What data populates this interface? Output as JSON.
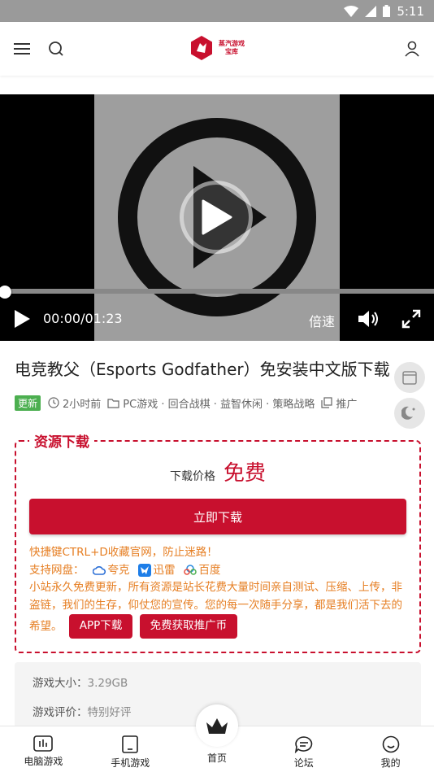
{
  "status": {
    "time": "5:11"
  },
  "header": {
    "logo_line1": "蒸汽游戏",
    "logo_line2": "宝库"
  },
  "video": {
    "time_display": "00:00/01:23",
    "speed_label": "倍速",
    "progress": 0.0
  },
  "article": {
    "title": "电竞教父（Esports Godfather）免安装中文版下载",
    "badge": "更新",
    "time_ago": "2小时前",
    "categories": "PC游戏 · 回合战棋 · 益智休闲 · 策略战略",
    "recommend": "推广"
  },
  "download": {
    "section_title": "资源下载",
    "price_label": "下载价格",
    "price_value": "免费",
    "button_label": "立即下载",
    "note_bookmark": "快捷键CTRL+D收藏官网，防止迷路！",
    "netdisk_label": "支持网盘：",
    "netdisks": [
      "夸克",
      "迅雷",
      "百度"
    ],
    "note_free": "小站永久免费更新，所有资源是站长花费大量时间亲自测试、压缩、上传，非盗链，我们的生存，仰仗您的宣传。您的每一次随手分享，都是我们活下去的希望。",
    "app_button": "APP下载",
    "promo_button": "免费获取推广币"
  },
  "info": {
    "size_label": "游戏大小：",
    "size_value": "3.29GB",
    "rating_label": "游戏评价：",
    "rating_value": "特别好评"
  },
  "tabbar": {
    "items": [
      {
        "label": "电脑游戏",
        "icon": "bar-chart-icon"
      },
      {
        "label": "手机游戏",
        "icon": "tablet-icon"
      },
      {
        "label": "首页",
        "icon": "crown-icon"
      },
      {
        "label": "论坛",
        "icon": "chat-icon"
      },
      {
        "label": "我的",
        "icon": "smile-icon"
      }
    ]
  },
  "colors": {
    "accent": "#c8102e",
    "note": "#e67e22",
    "badge": "#4caf50"
  }
}
